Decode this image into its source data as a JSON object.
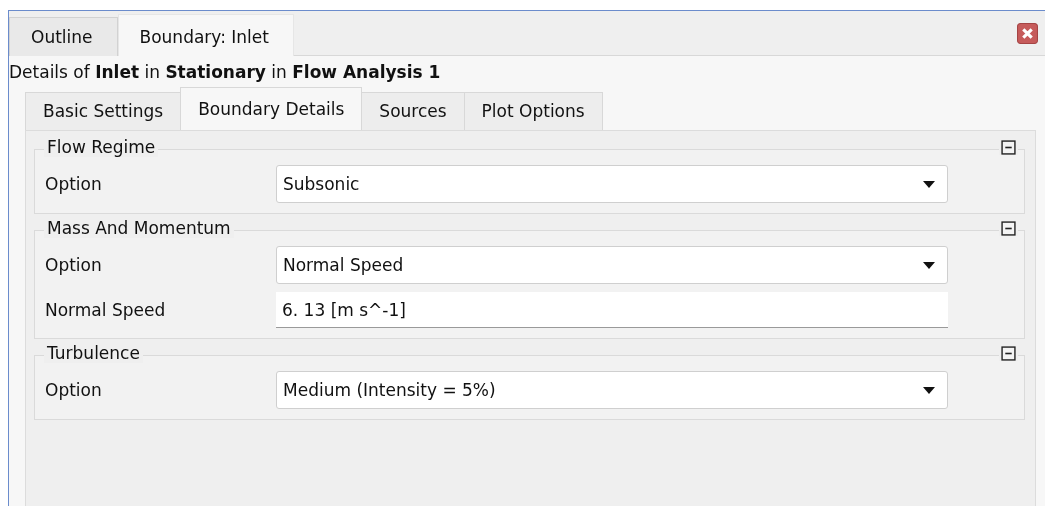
{
  "top_tabs": [
    {
      "label": "Outline",
      "selected": false
    },
    {
      "label": "Boundary: Inlet",
      "selected": true
    }
  ],
  "heading": "Details of **Inlet** in **Stationary** in **Flow Analysis 1**",
  "detail_tabs": [
    {
      "label": "Basic Settings",
      "selected": false
    },
    {
      "label": "Boundary Details",
      "selected": true
    },
    {
      "label": "Sources",
      "selected": false
    },
    {
      "label": "Plot Options",
      "selected": false
    }
  ],
  "groups": [
    {
      "title": "Flow Regime",
      "expanded": true,
      "rows": [
        {
          "label": "Option",
          "kind": "combo",
          "value": "Subsonic"
        }
      ]
    },
    {
      "title": "Mass And Momentum",
      "expanded": true,
      "rows": [
        {
          "label": "Option",
          "kind": "combo",
          "value": "Normal Speed"
        },
        {
          "label": "Normal Speed",
          "kind": "text",
          "value": "6. 13 [m s^-1]"
        }
      ]
    },
    {
      "title": "Turbulence",
      "expanded": true,
      "rows": [
        {
          "label": "Option",
          "kind": "combo",
          "value": "Medium (Intensity = 5%)"
        }
      ]
    }
  ]
}
